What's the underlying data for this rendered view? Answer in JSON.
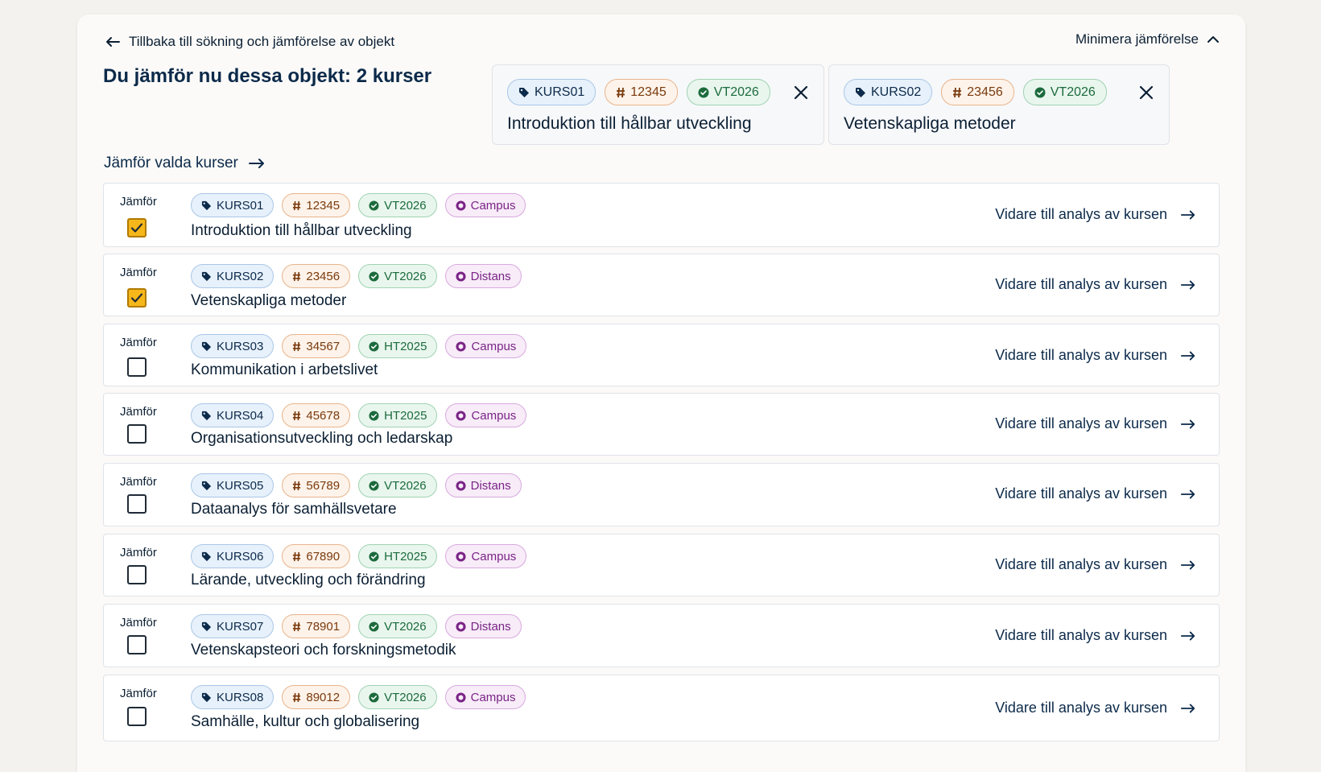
{
  "header": {
    "back_label": "Tillbaka till sökning och jämförelse av objekt",
    "minimize_label": "Minimera jämförelse",
    "title": "Du jämför nu dessa objekt: 2 kurser",
    "compare_action_label": "Jämför valda kurser"
  },
  "selected": [
    {
      "code": "KURS01",
      "number": "12345",
      "term": "VT2026",
      "title": "Introduktion till hållbar utveckling"
    },
    {
      "code": "KURS02",
      "number": "23456",
      "term": "VT2026",
      "title": "Vetenskapliga metoder"
    }
  ],
  "list": {
    "compare_label": "Jämför",
    "action_label": "Vidare till analys av kursen",
    "courses": [
      {
        "code": "KURS01",
        "number": "12345",
        "term": "VT2026",
        "mode": "Campus",
        "title": "Introduktion till hållbar utveckling",
        "checked": true
      },
      {
        "code": "KURS02",
        "number": "23456",
        "term": "VT2026",
        "mode": "Distans",
        "title": "Vetenskapliga metoder",
        "checked": true
      },
      {
        "code": "KURS03",
        "number": "34567",
        "term": "HT2025",
        "mode": "Campus",
        "title": "Kommunikation i arbetslivet",
        "checked": false
      },
      {
        "code": "KURS04",
        "number": "45678",
        "term": "HT2025",
        "mode": "Campus",
        "title": "Organisationsutveckling och ledarskap",
        "checked": false
      },
      {
        "code": "KURS05",
        "number": "56789",
        "term": "VT2026",
        "mode": "Distans",
        "title": "Dataanalys för samhällsvetare",
        "checked": false
      },
      {
        "code": "KURS06",
        "number": "67890",
        "term": "HT2025",
        "mode": "Campus",
        "title": "Lärande, utveckling och förändring",
        "checked": false
      },
      {
        "code": "KURS07",
        "number": "78901",
        "term": "VT2026",
        "mode": "Distans",
        "title": "Vetenskapsteori och forskningsmetodik",
        "checked": false
      },
      {
        "code": "KURS08",
        "number": "89012",
        "term": "VT2026",
        "mode": "Campus",
        "title": "Samhälle, kultur och globalisering",
        "checked": false
      }
    ]
  },
  "icons": {
    "back": "arrow-left-icon",
    "minimize": "chevron-up-icon",
    "compare": "arrow-right-icon",
    "close": "close-icon",
    "code": "tag-icon",
    "number": "hash-icon",
    "term": "check-badge-icon",
    "mode": "cube-icon",
    "checkbox": "check-icon"
  },
  "colors": {
    "background": "#f3f2ee",
    "card": "#fbfaf8",
    "text": "#0b1f33",
    "checkbox_checked": "#f6b71a",
    "badge_code": "#a9c7e6",
    "badge_number": "#e8b48c",
    "badge_term": "#9fd3b2",
    "badge_mode": "#d9a9df"
  }
}
